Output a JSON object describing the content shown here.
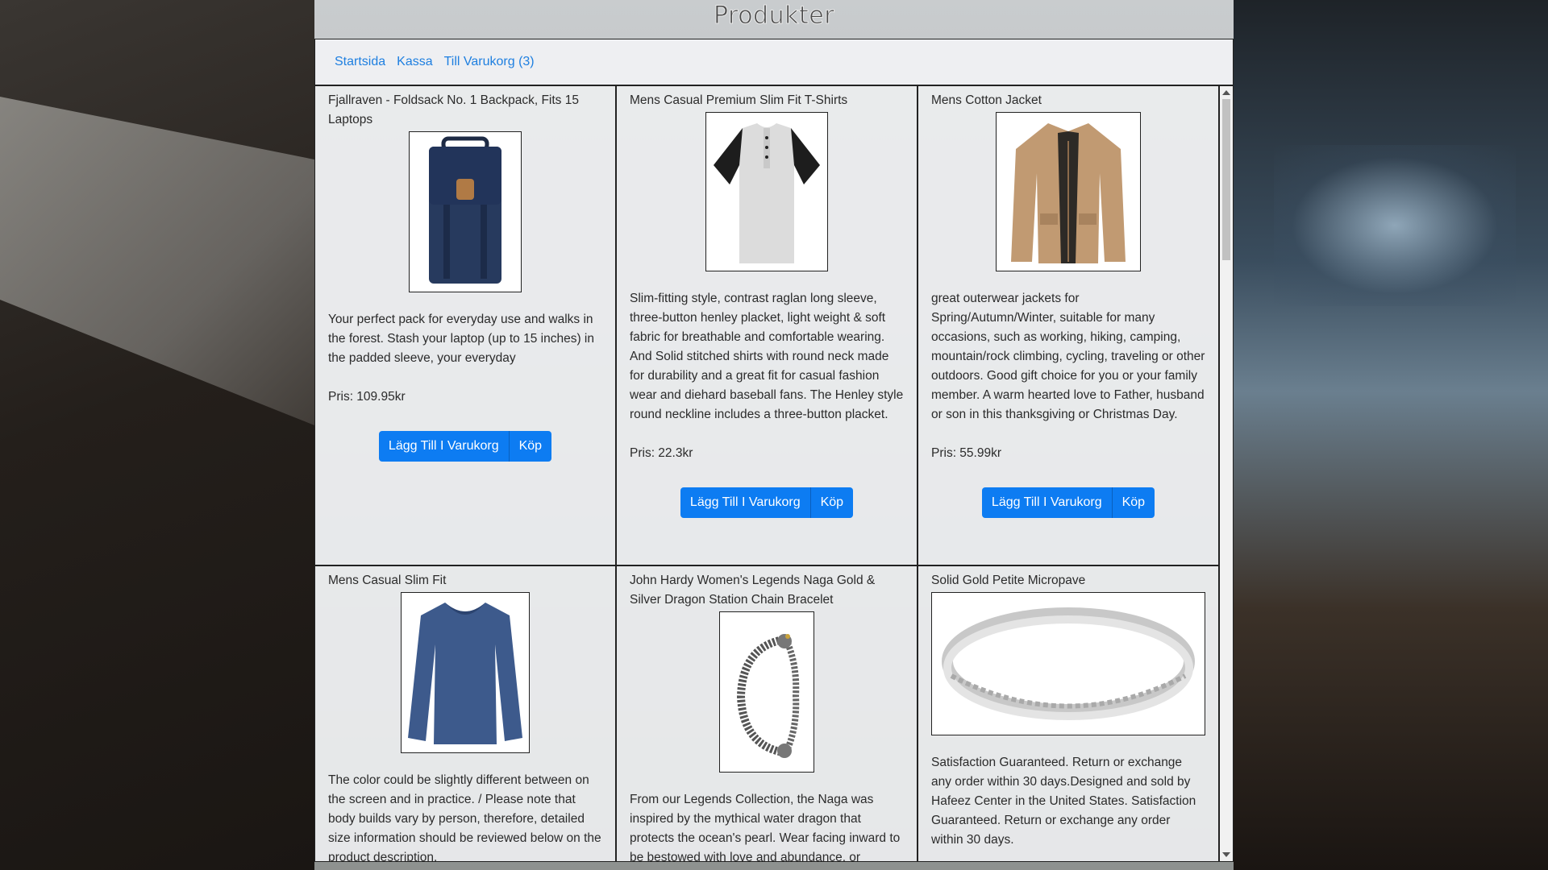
{
  "page": {
    "title": "Produkter"
  },
  "nav": {
    "home": "Startsida",
    "checkout": "Kassa",
    "cart": "Till Varukorg (3)"
  },
  "buttons": {
    "add_to_cart": "Lägg Till I Varukorg",
    "buy": "Köp"
  },
  "products": [
    {
      "title": "Fjallraven - Foldsack No. 1 Backpack, Fits 15 Laptops",
      "description": "Your perfect pack for everyday use and walks in the forest. Stash your laptop (up to 15 inches) in the padded sleeve, your everyday",
      "price": "Pris: 109.95kr",
      "icon": "backpack-icon"
    },
    {
      "title": "Mens Casual Premium Slim Fit T-Shirts",
      "description": "Slim-fitting style, contrast raglan long sleeve, three-button henley placket, light weight & soft fabric for breathable and comfortable wearing. And Solid stitched shirts with round neck made for durability and a great fit for casual fashion wear and diehard baseball fans. The Henley style round neckline includes a three-button placket.",
      "price": "Pris: 22.3kr",
      "icon": "tshirt-icon"
    },
    {
      "title": "Mens Cotton Jacket",
      "description": "great outerwear jackets for Spring/Autumn/Winter, suitable for many occasions, such as working, hiking, camping, mountain/rock climbing, cycling, traveling or other outdoors. Good gift choice for you or your family member. A warm hearted love to Father, husband or son in this thanksgiving or Christmas Day.",
      "price": "Pris: 55.99kr",
      "icon": "jacket-icon"
    },
    {
      "title": "Mens Casual Slim Fit",
      "description": "The color could be slightly different between on the screen and in practice. / Please note that body builds vary by person, therefore, detailed size information should be reviewed below on the product description.",
      "price": "",
      "icon": "longsleeve-icon"
    },
    {
      "title": "John Hardy Women's Legends Naga Gold & Silver Dragon Station Chain Bracelet",
      "description": "From our Legends Collection, the Naga was inspired by the mythical water dragon that protects the ocean's pearl. Wear facing inward to be bestowed with love and abundance, or",
      "price": "",
      "icon": "bracelet-icon"
    },
    {
      "title": "Solid Gold Petite Micropave",
      "description": "Satisfaction Guaranteed. Return or exchange any order within 30 days.Designed and sold by Hafeez Center in the United States. Satisfaction Guaranteed. Return or exchange any order within 30 days.",
      "price": "",
      "icon": "ring-icon"
    }
  ]
}
